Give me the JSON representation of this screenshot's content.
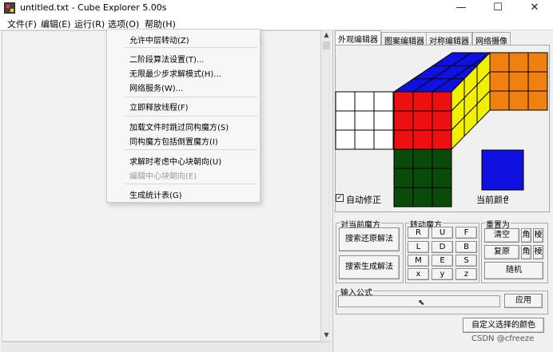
{
  "window": {
    "title": "untitled.txt - Cube Explorer 5.00s",
    "minimize_glyph": "—",
    "maximize_glyph": "☐",
    "close_glyph": "✕"
  },
  "menubar": {
    "items": [
      "文件(F)",
      "编辑(E)",
      "运行(R)",
      "选项(O)",
      "帮助(H)"
    ]
  },
  "options_menu": {
    "items": [
      "允许中层转动(Z)",
      "二阶段算法设置(T)...",
      "无限最少步求解模式(H)...",
      "网络服务(W)...",
      "立即释放线程(F)",
      "加载文件时跳过同构魔方(S)",
      "同构魔方包括倒置魔方(I)",
      "求解时考虑中心块朝向(U)",
      "编辑中心块朝向(E)",
      "生成统计表(G)"
    ],
    "disabled_index": 8
  },
  "tabs": [
    "外观编辑器",
    "图案编辑器",
    "对称编辑器",
    "网络摄像"
  ],
  "editor": {
    "auto_correct_label": "自动修正",
    "auto_correct_checked": true,
    "current_color_label": "当前颜色",
    "current_color": "#1010e0"
  },
  "colors": {
    "up": "#1010e0",
    "front": "#ee1010",
    "right": "#f0f000",
    "left": "#ffffff",
    "back": "#f08010",
    "down": "#0a4a0a"
  },
  "groups": {
    "current_cube": {
      "title": "对当前魔方",
      "search_solution": "搜索还原解法",
      "search_generator": "搜索生成解法"
    },
    "turn_cube": {
      "title": "转动魔方",
      "buttons": [
        "R",
        "U",
        "F",
        "L",
        "D",
        "B",
        "M",
        "E",
        "S",
        "x",
        "y",
        "z"
      ]
    },
    "reset": {
      "title": "重置为",
      "clear": "清空",
      "restore": "复原",
      "random": "随机",
      "corner": "角",
      "edge": "棱"
    },
    "formula": {
      "title": "输入公式",
      "value": "",
      "apply": "应用"
    }
  },
  "custom_colors_button": "自定义选择的颜色",
  "watermark": "CSDN @cfreeze"
}
